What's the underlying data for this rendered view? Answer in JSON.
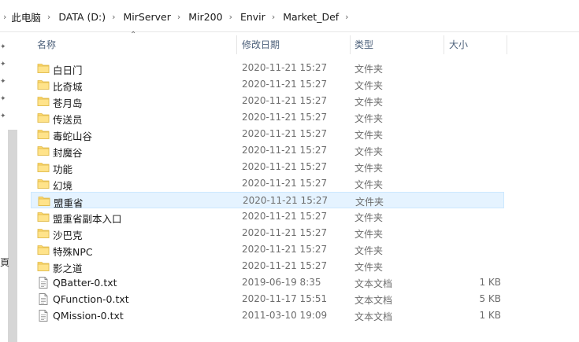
{
  "breadcrumb": [
    "此电脑",
    "DATA (D:)",
    "MirServer",
    "Mir200",
    "Envir",
    "Market_Def"
  ],
  "columns": {
    "name": "名称",
    "date": "修改日期",
    "type": "类型",
    "size": "大小"
  },
  "left_cut_text": "頁",
  "rows": [
    {
      "kind": "folder",
      "name": "白日门",
      "date": "2020-11-21 15:27",
      "type": "文件夹",
      "size": ""
    },
    {
      "kind": "folder",
      "name": "比奇城",
      "date": "2020-11-21 15:27",
      "type": "文件夹",
      "size": ""
    },
    {
      "kind": "folder",
      "name": "苍月岛",
      "date": "2020-11-21 15:27",
      "type": "文件夹",
      "size": ""
    },
    {
      "kind": "folder",
      "name": "传送员",
      "date": "2020-11-21 15:27",
      "type": "文件夹",
      "size": ""
    },
    {
      "kind": "folder",
      "name": "毒蛇山谷",
      "date": "2020-11-21 15:27",
      "type": "文件夹",
      "size": ""
    },
    {
      "kind": "folder",
      "name": "封魔谷",
      "date": "2020-11-21 15:27",
      "type": "文件夹",
      "size": ""
    },
    {
      "kind": "folder",
      "name": "功能",
      "date": "2020-11-21 15:27",
      "type": "文件夹",
      "size": ""
    },
    {
      "kind": "folder",
      "name": "幻境",
      "date": "2020-11-21 15:27",
      "type": "文件夹",
      "size": ""
    },
    {
      "kind": "folder",
      "name": "盟重省",
      "date": "2020-11-21 15:27",
      "type": "文件夹",
      "size": "",
      "selected": true
    },
    {
      "kind": "folder",
      "name": "盟重省副本入口",
      "date": "2020-11-21 15:27",
      "type": "文件夹",
      "size": ""
    },
    {
      "kind": "folder",
      "name": "沙巴克",
      "date": "2020-11-21 15:27",
      "type": "文件夹",
      "size": ""
    },
    {
      "kind": "folder",
      "name": "特殊NPC",
      "date": "2020-11-21 15:27",
      "type": "文件夹",
      "size": ""
    },
    {
      "kind": "folder",
      "name": "影之道",
      "date": "2020-11-21 15:27",
      "type": "文件夹",
      "size": ""
    },
    {
      "kind": "file",
      "name": "QBatter-0.txt",
      "date": "2019-06-19 8:35",
      "type": "文本文档",
      "size": "1 KB"
    },
    {
      "kind": "file",
      "name": "QFunction-0.txt",
      "date": "2020-11-17 15:51",
      "type": "文本文档",
      "size": "5 KB"
    },
    {
      "kind": "file",
      "name": "QMission-0.txt",
      "date": "2011-03-10 19:09",
      "type": "文本文档",
      "size": "1 KB"
    }
  ],
  "icons": {
    "folder": "folder-icon",
    "file": "text-file-icon"
  },
  "colors": {
    "header_text": "#4c607a",
    "selection_bg": "#e5f3ff",
    "selection_border": "#cce8ff",
    "folder": "#ffd86b"
  }
}
